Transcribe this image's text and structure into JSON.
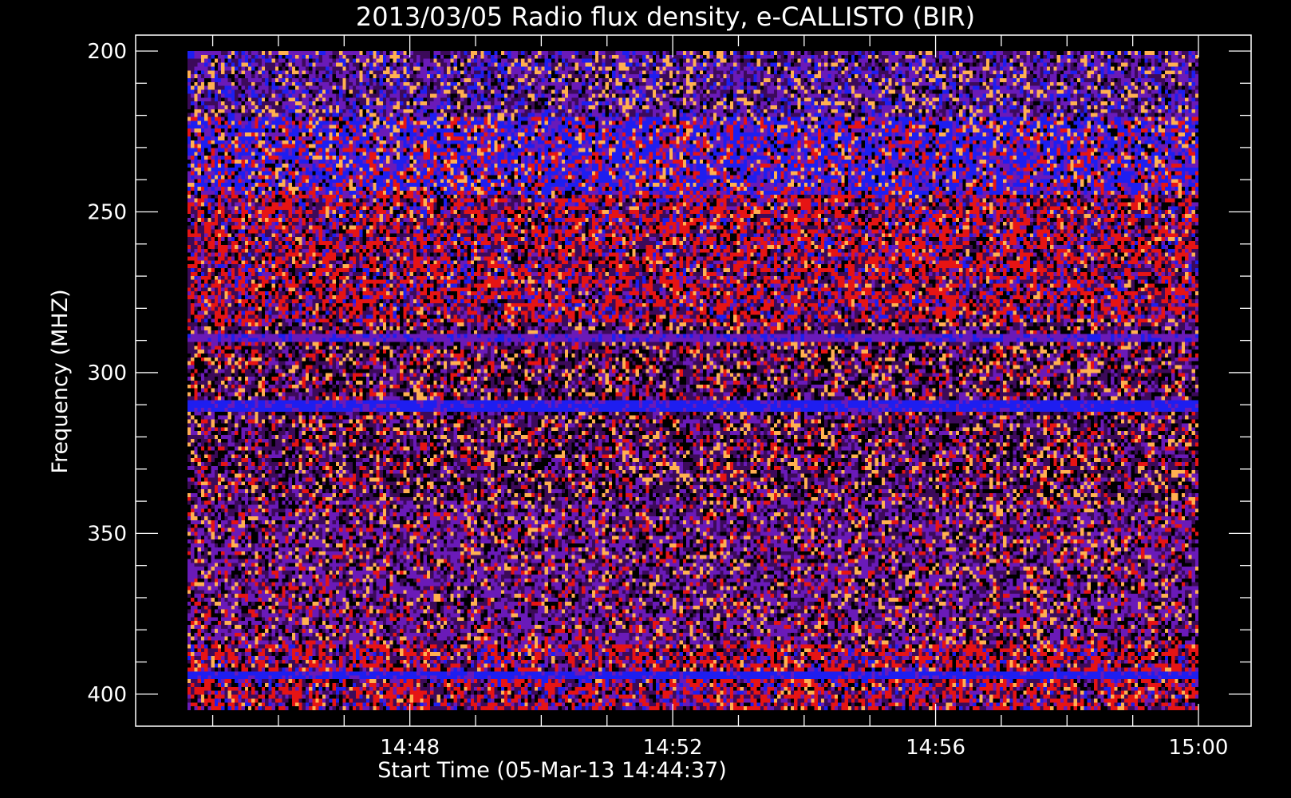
{
  "chart_data": {
    "type": "heatmap",
    "title": "2013/03/05  Radio flux density, e-CALLISTO (BIR)",
    "xlabel": "Start Time (05-Mar-13 14:44:37)",
    "ylabel": "Frequency (MHZ)",
    "x_range": [
      "14:44:37",
      "15:00:00"
    ],
    "y_range": [
      200,
      405
    ],
    "y_inverted": true,
    "x_tick_labels": [
      "14:48",
      "14:52",
      "14:56",
      "15:00"
    ],
    "y_tick_labels": [
      200,
      250,
      300,
      350,
      400
    ],
    "colormap": [
      "#000000",
      "#3c0a5a",
      "#6a1ab8",
      "#1e1ef0",
      "#e61414",
      "#ffb050"
    ],
    "bands": [
      {
        "from": 200,
        "to": 220,
        "level": "violet-high"
      },
      {
        "from": 220,
        "to": 245,
        "level": "blue"
      },
      {
        "from": 245,
        "to": 285,
        "level": "red"
      },
      {
        "from": 288,
        "to": 291,
        "level": "violet-line"
      },
      {
        "from": 291,
        "to": 340,
        "level": "dark-violet"
      },
      {
        "from": 309,
        "to": 312,
        "level": "blue-line"
      },
      {
        "from": 340,
        "to": 385,
        "level": "violet"
      },
      {
        "from": 385,
        "to": 405,
        "level": "red"
      },
      {
        "from": 393,
        "to": 395,
        "level": "blue-line"
      }
    ]
  }
}
